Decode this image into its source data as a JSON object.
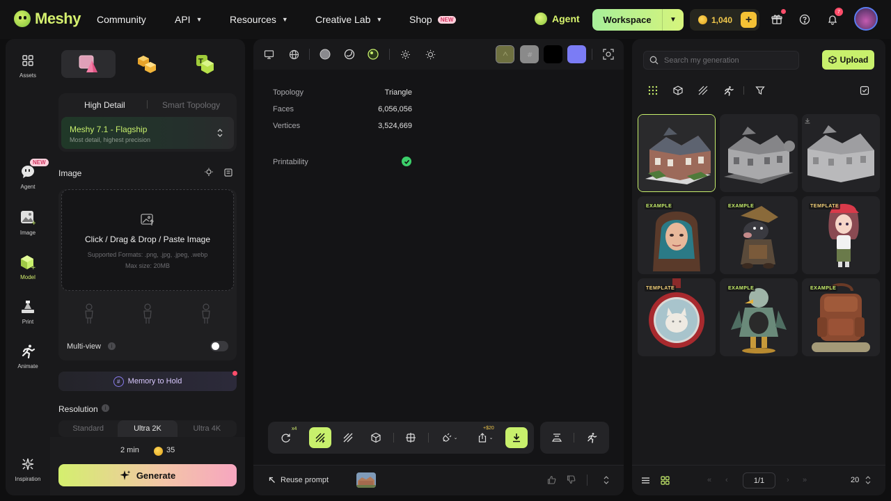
{
  "brand": {
    "name": "Meshy"
  },
  "nav": {
    "community": "Community",
    "api": "API",
    "resources": "Resources",
    "creative_lab": "Creative Lab",
    "shop": "Shop",
    "shop_badge": "NEW",
    "agent": "Agent",
    "workspace": "Workspace",
    "credits": "1,040",
    "notifications_count": "7"
  },
  "rail": {
    "assets": "Assets",
    "agent": "Agent",
    "agent_badge": "NEW",
    "image": "Image",
    "model": "Model",
    "print": "Print",
    "animate": "Animate",
    "inspiration": "Inspiration",
    "active": "model"
  },
  "generator": {
    "quality_tabs": [
      "High Detail",
      "Smart Topology"
    ],
    "model_name": "Meshy 7.1 - Flagship",
    "model_desc": "Most detail, highest precision",
    "image_label": "Image",
    "upload_title": "Click / Drag & Drop / Paste Image",
    "upload_formats": "Supported Formats: .png, .jpg, .jpeg, .webp",
    "upload_max": "Max size: 20MB",
    "multiview_label": "Multi-view",
    "multiview_on": false,
    "memory_label": "Memory to Hold",
    "resolution_label": "Resolution",
    "resolution_options": [
      "Standard",
      "Ultra 2K",
      "Ultra 4K"
    ],
    "resolution_selected": "Ultra 2K",
    "time_estimate": "2 min",
    "credit_cost": "35",
    "generate_label": "Generate"
  },
  "viewer": {
    "swatch_colors": [
      "#6e7040",
      "#8a8a8a",
      "#000000",
      "#7b7cf5"
    ],
    "stats": [
      {
        "label": "Topology",
        "value": "Triangle"
      },
      {
        "label": "Faces",
        "value": "6,056,056"
      },
      {
        "label": "Vertices",
        "value": "3,524,669"
      }
    ],
    "printability_label": "Printability",
    "retry_badge": "x4",
    "export_price": "+$20",
    "reuse_prompt": "Reuse prompt"
  },
  "library": {
    "search_placeholder": "Search my generation",
    "upload_label": "Upload",
    "items": [
      {
        "tag": "",
        "subject": "house-textured",
        "selected": true
      },
      {
        "tag": "",
        "subject": "house-gray"
      },
      {
        "tag": "",
        "subject": "house-white",
        "download": true
      },
      {
        "tag": "EXAMPLE",
        "subject": "hooded-girl"
      },
      {
        "tag": "EXAMPLE",
        "subject": "mole-adventurer"
      },
      {
        "tag": "TEMPLATE",
        "subject": "anime-girl"
      },
      {
        "tag": "TEMPLATE",
        "subject": "cat-medallion"
      },
      {
        "tag": "EXAMPLE",
        "subject": "bird-warrior"
      },
      {
        "tag": "EXAMPLE",
        "subject": "leather-backpack"
      }
    ],
    "page": "1/1",
    "page_size": "20"
  }
}
